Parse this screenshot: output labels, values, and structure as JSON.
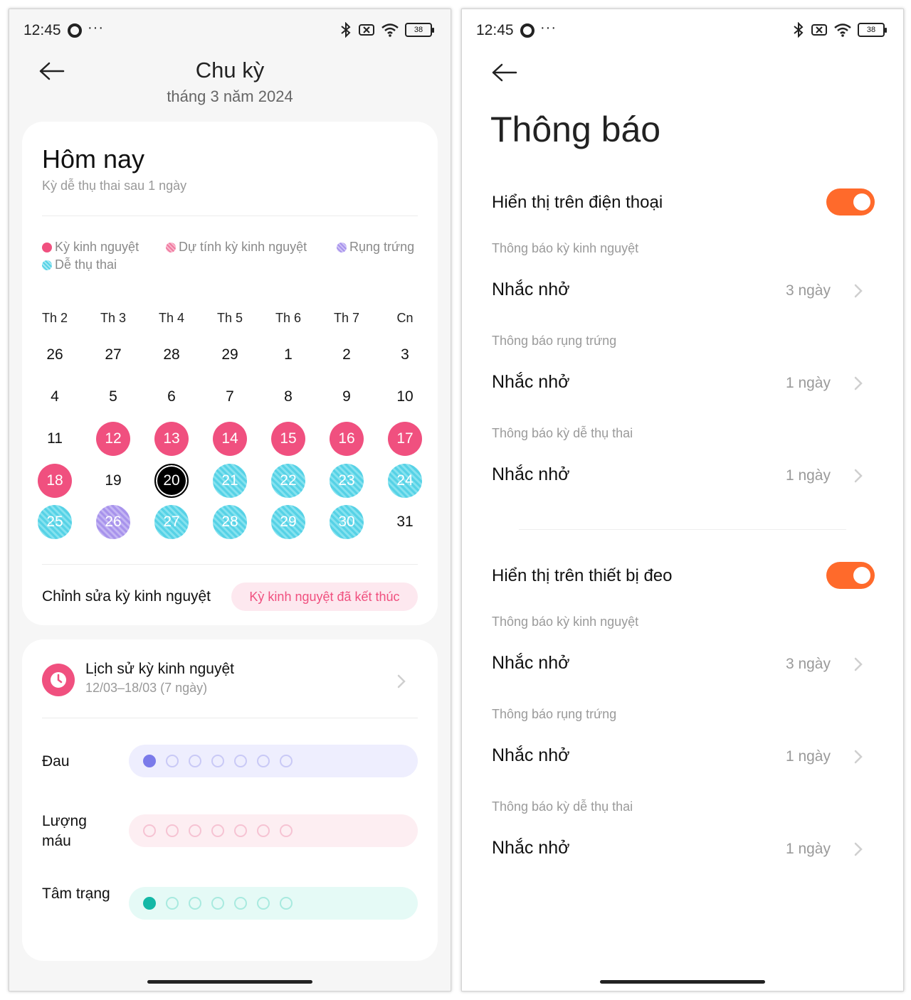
{
  "status_bar": {
    "time": "12:45",
    "dots": "···",
    "battery": "38"
  },
  "left": {
    "header": {
      "title": "Chu kỳ",
      "subtitle": "tháng 3 năm 2024"
    },
    "today": {
      "title": "Hôm nay",
      "subtitle": "Kỳ dễ thụ thai sau 1 ngày"
    },
    "legend": [
      {
        "label": "Kỳ kinh nguyệt",
        "color": "#f0507f"
      },
      {
        "label": "Dự tính kỳ kinh nguyệt",
        "color": "#f59ab8"
      },
      {
        "label": "Rụng trứng",
        "color": "#a893ec"
      },
      {
        "label": "Dễ thụ thai",
        "color": "#56d2e6"
      }
    ],
    "weekdays": [
      "Th 2",
      "Th 3",
      "Th 4",
      "Th 5",
      "Th 6",
      "Th 7",
      "Cn"
    ],
    "days": [
      [
        "26",
        "27",
        "28",
        "29",
        "1",
        "2",
        "3"
      ],
      [
        "4",
        "5",
        "6",
        "7",
        "8",
        "9",
        "10"
      ],
      [
        "11",
        "12",
        "13",
        "14",
        "15",
        "16",
        "17"
      ],
      [
        "18",
        "19",
        "20",
        "21",
        "22",
        "23",
        "24"
      ],
      [
        "25",
        "26",
        "27",
        "28",
        "29",
        "30",
        "31"
      ]
    ],
    "day_states": [
      [
        "",
        "",
        "",
        "",
        "",
        "",
        ""
      ],
      [
        "",
        "",
        "",
        "",
        "",
        "",
        ""
      ],
      [
        "",
        "period",
        "period",
        "period",
        "period",
        "period",
        "period"
      ],
      [
        "period",
        "",
        "today",
        "fertile",
        "fertile",
        "fertile",
        "fertile"
      ],
      [
        "fertile",
        "ovulation",
        "fertile",
        "fertile",
        "fertile",
        "fertile",
        ""
      ]
    ],
    "edit_label": "Chỉnh sửa kỳ kinh nguyệt",
    "edit_button": "Kỳ kinh nguyệt đã kết thúc",
    "history": {
      "title": "Lịch sử kỳ kinh nguyệt",
      "range": "12/03–18/03 (7 ngày)"
    },
    "trackers": [
      {
        "label": "Đau",
        "filled": 1,
        "total": 7,
        "bg": "#eeeefe",
        "fill": "#7b7bea",
        "ring": "#c9c9f6"
      },
      {
        "label": "Lượng máu",
        "filled": 0,
        "total": 7,
        "bg": "#fdeef2",
        "fill": "#f59ab8",
        "ring": "#f6c3d3"
      },
      {
        "label": "Tâm trạng",
        "filled": 1,
        "total": 7,
        "bg": "#e5faf6",
        "fill": "#14b8a6",
        "ring": "#a8eadf"
      }
    ]
  },
  "right": {
    "title": "Thông báo",
    "sections": [
      {
        "title": "Hiển thị trên điện thoại",
        "toggle_on": true,
        "items": [
          {
            "sub": "Thông báo kỳ kinh nguyệt",
            "label": "Nhắc nhở",
            "value": "3 ngày"
          },
          {
            "sub": "Thông báo rụng trứng",
            "label": "Nhắc nhở",
            "value": "1 ngày"
          },
          {
            "sub": "Thông báo kỳ dễ thụ thai",
            "label": "Nhắc nhở",
            "value": "1 ngày"
          }
        ]
      },
      {
        "title": "Hiển thị trên thiết bị đeo",
        "toggle_on": true,
        "items": [
          {
            "sub": "Thông báo kỳ kinh nguyệt",
            "label": "Nhắc nhở",
            "value": "3 ngày"
          },
          {
            "sub": "Thông báo rụng trứng",
            "label": "Nhắc nhở",
            "value": "1 ngày"
          },
          {
            "sub": "Thông báo kỳ dễ thụ thai",
            "label": "Nhắc nhở",
            "value": "1 ngày"
          }
        ]
      }
    ]
  },
  "colors": {
    "accent_toggle": "#ff6a2b",
    "period": "#f0507f",
    "fertile": "#56d2e6",
    "ovulation": "#a893ec"
  }
}
